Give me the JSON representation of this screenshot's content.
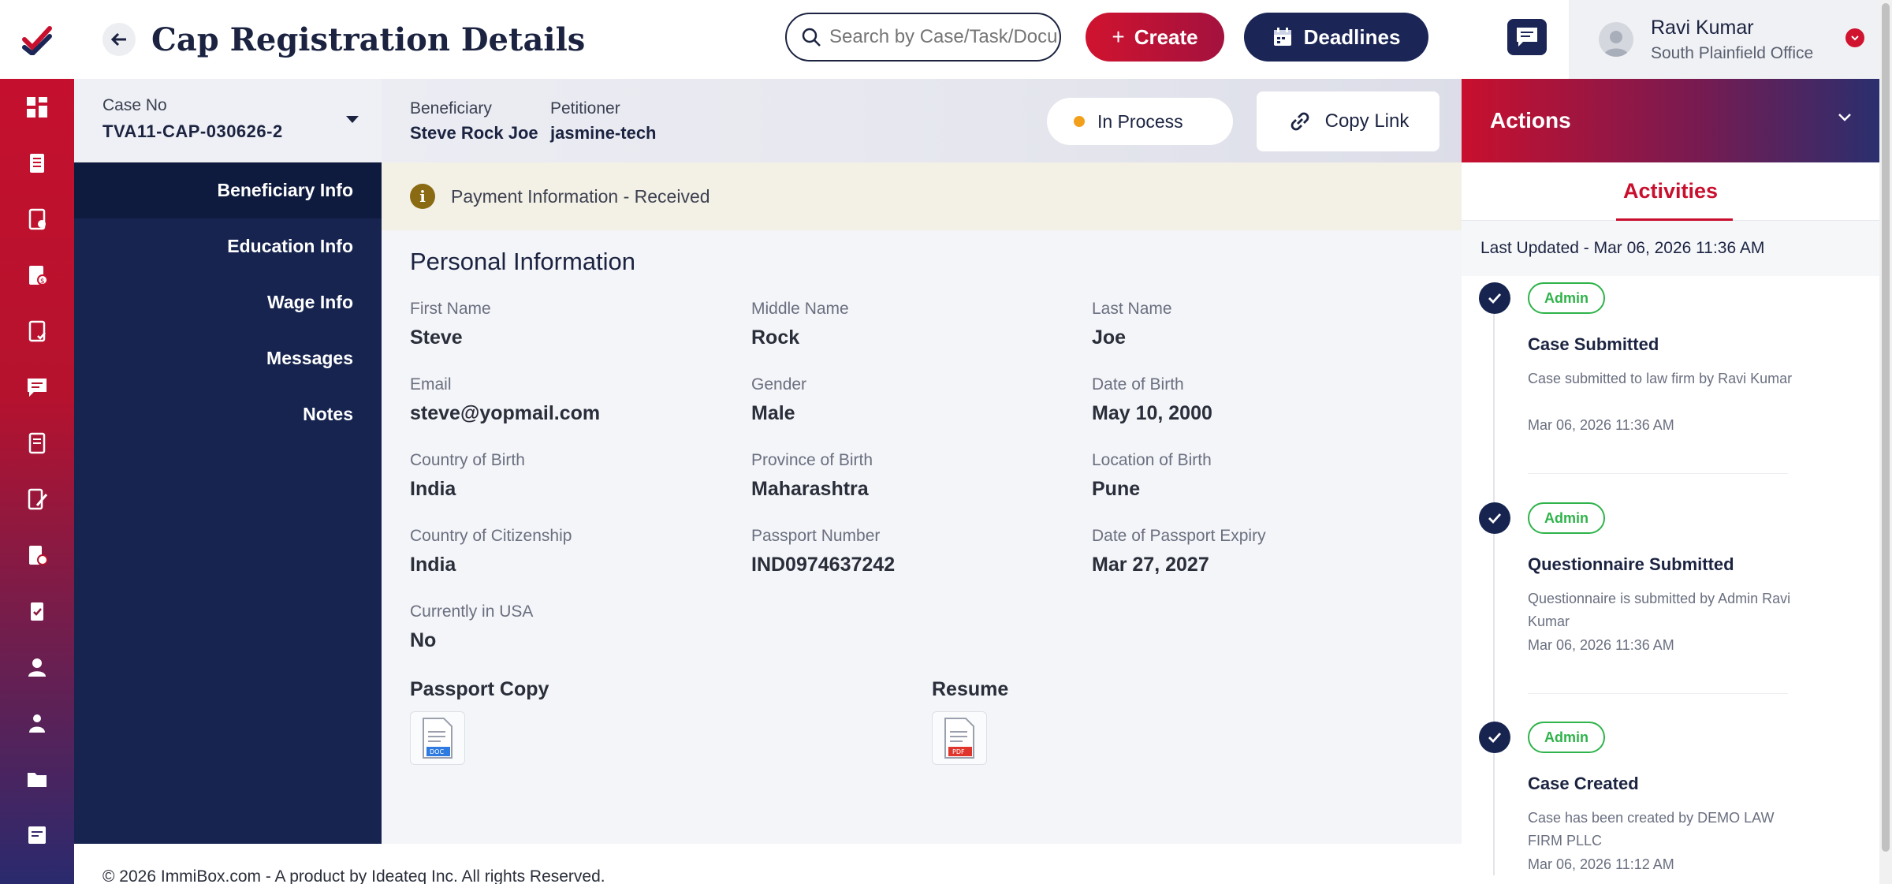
{
  "header": {
    "title": "Cap Registration Details",
    "search_placeholder": "Search by Case/Task/Docu",
    "create_label": "Create",
    "deadlines_label": "Deadlines",
    "user_name": "Ravi Kumar",
    "user_office": "South Plainfield Office"
  },
  "rail": {
    "icons": [
      "dashboard-icon",
      "cases-icon",
      "forms-icon",
      "invoice-icon",
      "tasks-icon",
      "messages-icon",
      "documents-icon",
      "reports-icon",
      "approvals-icon",
      "checklist-icon",
      "user-icon",
      "team-icon",
      "folder-icon",
      "notes-icon"
    ]
  },
  "case": {
    "case_no_label": "Case No",
    "case_no": "TVA11-CAP-030626-2",
    "beneficiary_label": "Beneficiary",
    "beneficiary": "Steve Rock Joe",
    "petitioner_label": "Petitioner",
    "petitioner": "jasmine-tech",
    "status": "In Process",
    "copy_link_label": "Copy Link"
  },
  "subnav": {
    "items": [
      "Beneficiary Info",
      "Education Info",
      "Wage Info",
      "Messages",
      "Notes"
    ]
  },
  "main": {
    "banner": "Payment Information - Received",
    "section_title": "Personal Information",
    "fields": [
      {
        "label": "First Name",
        "value": "Steve"
      },
      {
        "label": "Middle Name",
        "value": "Rock"
      },
      {
        "label": "Last Name",
        "value": "Joe"
      },
      {
        "label": "Email",
        "value": "steve@yopmail.com"
      },
      {
        "label": "Gender",
        "value": "Male"
      },
      {
        "label": "Date of Birth",
        "value": "May 10, 2000"
      },
      {
        "label": "Country of Birth",
        "value": "India"
      },
      {
        "label": "Province of Birth",
        "value": "Maharashtra"
      },
      {
        "label": "Location of Birth",
        "value": "Pune"
      },
      {
        "label": "Country of Citizenship",
        "value": "India"
      },
      {
        "label": "Passport Number",
        "value": "IND0974637242"
      },
      {
        "label": "Date of Passport Expiry",
        "value": "Mar 27, 2027"
      },
      {
        "label": "Currently in USA",
        "value": "No"
      }
    ],
    "passport_copy_label": "Passport Copy",
    "resume_label": "Resume",
    "doc_badge": "DOC",
    "pdf_badge": "PDF"
  },
  "footer": {
    "text": "© 2026 ImmiBox.com - A product by Ideateq Inc. All rights Reserved."
  },
  "actions": {
    "title": "Actions",
    "tab": "Activities",
    "last_updated": "Last Updated - Mar 06, 2026 11:36 AM",
    "activities": [
      {
        "badge": "Admin",
        "title": "Case Submitted",
        "desc": "Case submitted to law firm by Ravi Kumar",
        "time": "Mar 06, 2026 11:36 AM"
      },
      {
        "badge": "Admin",
        "title": "Questionnaire Submitted",
        "desc": "Questionnaire is submitted by Admin Ravi Kumar",
        "time": "Mar 06, 2026 11:36 AM"
      },
      {
        "badge": "Admin",
        "title": "Case Created",
        "desc": "Case has been created by DEMO LAW FIRM PLLC",
        "time": "Mar 06, 2026 11:12 AM"
      }
    ]
  },
  "colors": {
    "brand_red": "#c8102e",
    "navy": "#16244f",
    "status_dot": "#f2a01c",
    "badge_green": "#2fb34a"
  }
}
